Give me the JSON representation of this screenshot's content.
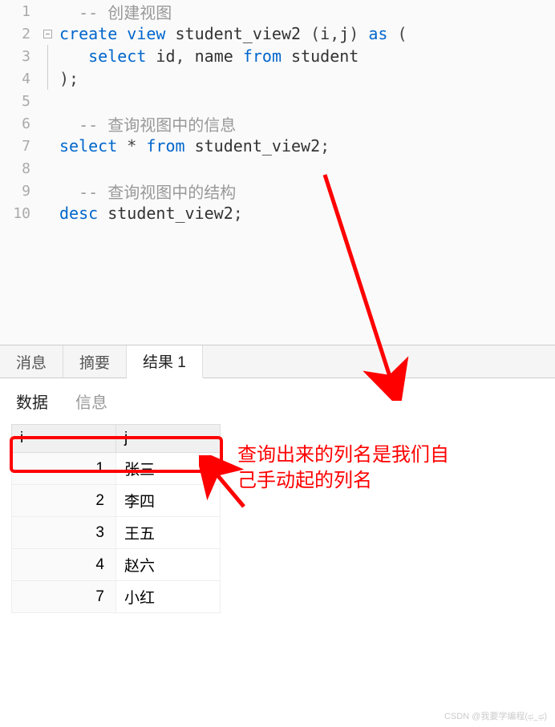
{
  "code": {
    "lines": [
      {
        "n": "1",
        "tokens": [
          [
            "c-punct",
            "  "
          ],
          [
            "c-comment",
            "-- 创建视图"
          ]
        ]
      },
      {
        "n": "2",
        "fold": "start",
        "tokens": [
          [
            "c-keyword",
            "create"
          ],
          [
            "c-punct",
            " "
          ],
          [
            "c-keyword",
            "view"
          ],
          [
            "c-punct",
            " "
          ],
          [
            "c-ident",
            "student_view2"
          ],
          [
            "c-punct",
            " ("
          ],
          [
            "c-ident",
            "i"
          ],
          [
            "c-punct",
            ","
          ],
          [
            "c-ident",
            "j"
          ],
          [
            "c-punct",
            ") "
          ],
          [
            "c-keyword",
            "as"
          ],
          [
            "c-punct",
            " ("
          ]
        ]
      },
      {
        "n": "3",
        "fold": "mid",
        "tokens": [
          [
            "c-punct",
            "   "
          ],
          [
            "c-keyword",
            "select"
          ],
          [
            "c-punct",
            " "
          ],
          [
            "c-ident",
            "id"
          ],
          [
            "c-punct",
            ", "
          ],
          [
            "c-ident",
            "name"
          ],
          [
            "c-punct",
            " "
          ],
          [
            "c-keyword",
            "from"
          ],
          [
            "c-punct",
            " "
          ],
          [
            "c-ident",
            "student"
          ]
        ]
      },
      {
        "n": "4",
        "fold": "end",
        "tokens": [
          [
            "c-punct",
            ");"
          ]
        ]
      },
      {
        "n": "5",
        "tokens": []
      },
      {
        "n": "6",
        "tokens": [
          [
            "c-punct",
            "  "
          ],
          [
            "c-comment",
            "-- 查询视图中的信息"
          ]
        ]
      },
      {
        "n": "7",
        "tokens": [
          [
            "c-keyword",
            "select"
          ],
          [
            "c-punct",
            " * "
          ],
          [
            "c-keyword",
            "from"
          ],
          [
            "c-punct",
            " "
          ],
          [
            "c-ident",
            "student_view2"
          ],
          [
            "c-punct",
            ";"
          ]
        ]
      },
      {
        "n": "8",
        "tokens": []
      },
      {
        "n": "9",
        "tokens": [
          [
            "c-punct",
            "  "
          ],
          [
            "c-comment",
            "-- 查询视图中的结构"
          ]
        ]
      },
      {
        "n": "10",
        "tokens": [
          [
            "c-keyword",
            "desc"
          ],
          [
            "c-punct",
            " "
          ],
          [
            "c-ident",
            "student_view2"
          ],
          [
            "c-punct",
            ";"
          ]
        ]
      }
    ]
  },
  "tabs": {
    "items": [
      "消息",
      "摘要",
      "结果 1"
    ],
    "active": 2
  },
  "subtabs": {
    "items": [
      "数据",
      "信息"
    ],
    "active": 0
  },
  "table": {
    "headers": [
      "i",
      "j"
    ],
    "rows": [
      [
        "1",
        "张三"
      ],
      [
        "2",
        "李四"
      ],
      [
        "3",
        "王五"
      ],
      [
        "4",
        "赵六"
      ],
      [
        "7",
        "小红"
      ]
    ]
  },
  "annotation": {
    "line1": "查询出来的列名是我们自",
    "line2": "己手动起的列名"
  },
  "watermark": "CSDN @我要学编程(ಥ_ಥ)"
}
